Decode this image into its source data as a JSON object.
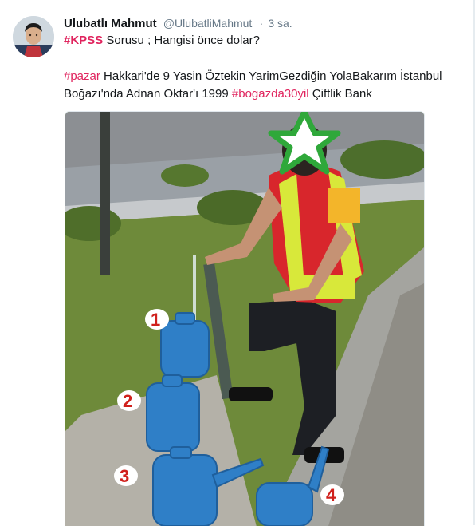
{
  "tweet": {
    "author_name": "Ulubatlı Mahmut",
    "author_handle": "@UlubatliMahmut",
    "separator": "·",
    "time": "3 sa.",
    "line1": {
      "hashtag": "#KPSS",
      "text": " Sorusu ; Hangisi önce dolar?"
    },
    "line2": {
      "hashtag1": "#pazar",
      "text1": " Hakkari'de 9 Yasin Öztekin YarimGezdiğin YolaBakarım İstanbul Boğazı'nda Adnan Oktar'ı 1999 ",
      "hashtag2": "#bogazda30yil",
      "text2": " Çiftlik Bank"
    }
  },
  "photo": {
    "subject": "man pouring water into connected blue watering cans",
    "labels": [
      "1",
      "2",
      "3",
      "4"
    ],
    "colors": {
      "can": "#2f7fc7",
      "label_text": "#d0201c",
      "star": "#2fa83a",
      "vest": "#d8e83a",
      "shirt": "#d8262c"
    }
  },
  "avatar": {
    "icon": "user-photo"
  }
}
